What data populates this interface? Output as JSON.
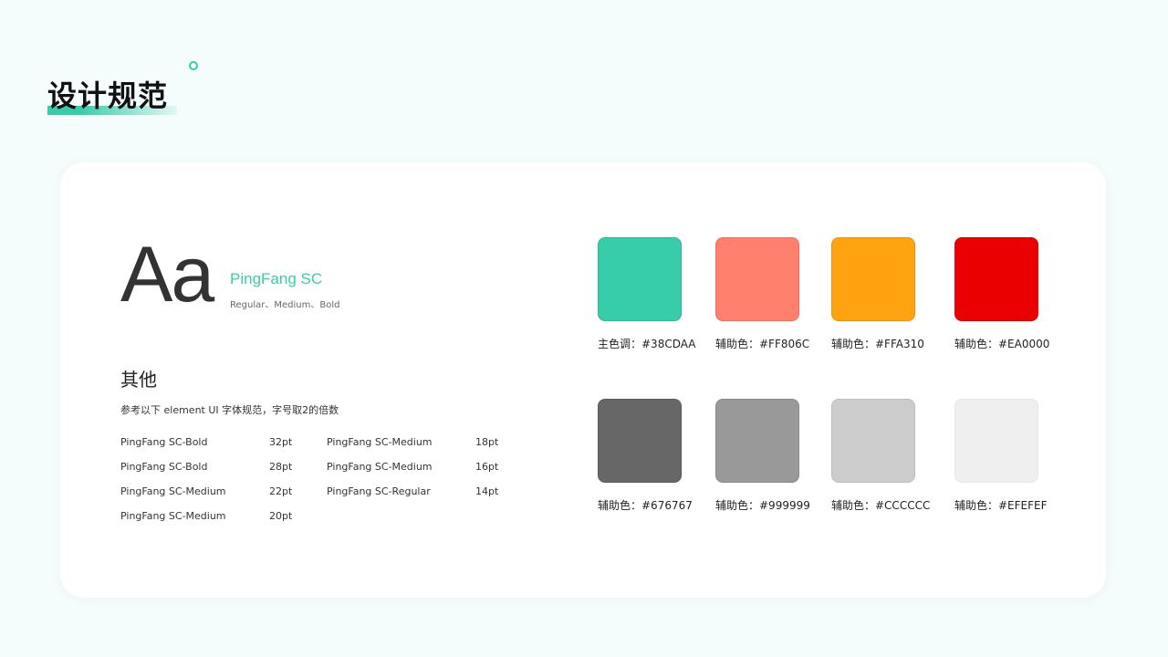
{
  "header": {
    "title": "设计规范"
  },
  "typography": {
    "sample": "Aa",
    "font_name": "PingFang SC",
    "weights": "Regular、Medium、Bold"
  },
  "other": {
    "title": "其他",
    "description": "参考以下 element UI 字体规范，字号取2的倍数",
    "specs_left": [
      {
        "name": "PingFang SC-Bold",
        "size": "32pt"
      },
      {
        "name": "PingFang SC-Bold",
        "size": "28pt"
      },
      {
        "name": "PingFang SC-Medium",
        "size": "22pt"
      },
      {
        "name": "PingFang SC-Medium",
        "size": "20pt"
      }
    ],
    "specs_right": [
      {
        "name": "PingFang SC-Medium",
        "size": "18pt"
      },
      {
        "name": "PingFang SC-Medium",
        "size": "16pt"
      },
      {
        "name": "PingFang SC-Regular",
        "size": "14pt"
      }
    ]
  },
  "colors": [
    {
      "label": "主色调：#38CDAA",
      "hex": "#38CDAA"
    },
    {
      "label": "辅助色：#FF806C",
      "hex": "#FF806C"
    },
    {
      "label": "辅助色：#FFA310",
      "hex": "#FFA310"
    },
    {
      "label": "辅助色：#EA0000",
      "hex": "#EA0000"
    },
    {
      "label": "辅助色：#676767",
      "hex": "#676767"
    },
    {
      "label": "辅助色：#999999",
      "hex": "#999999"
    },
    {
      "label": "辅助色：#CCCCCC",
      "hex": "#CCCCCC"
    },
    {
      "label": "辅助色：#EFEFEF",
      "hex": "#EFEFEF"
    }
  ]
}
